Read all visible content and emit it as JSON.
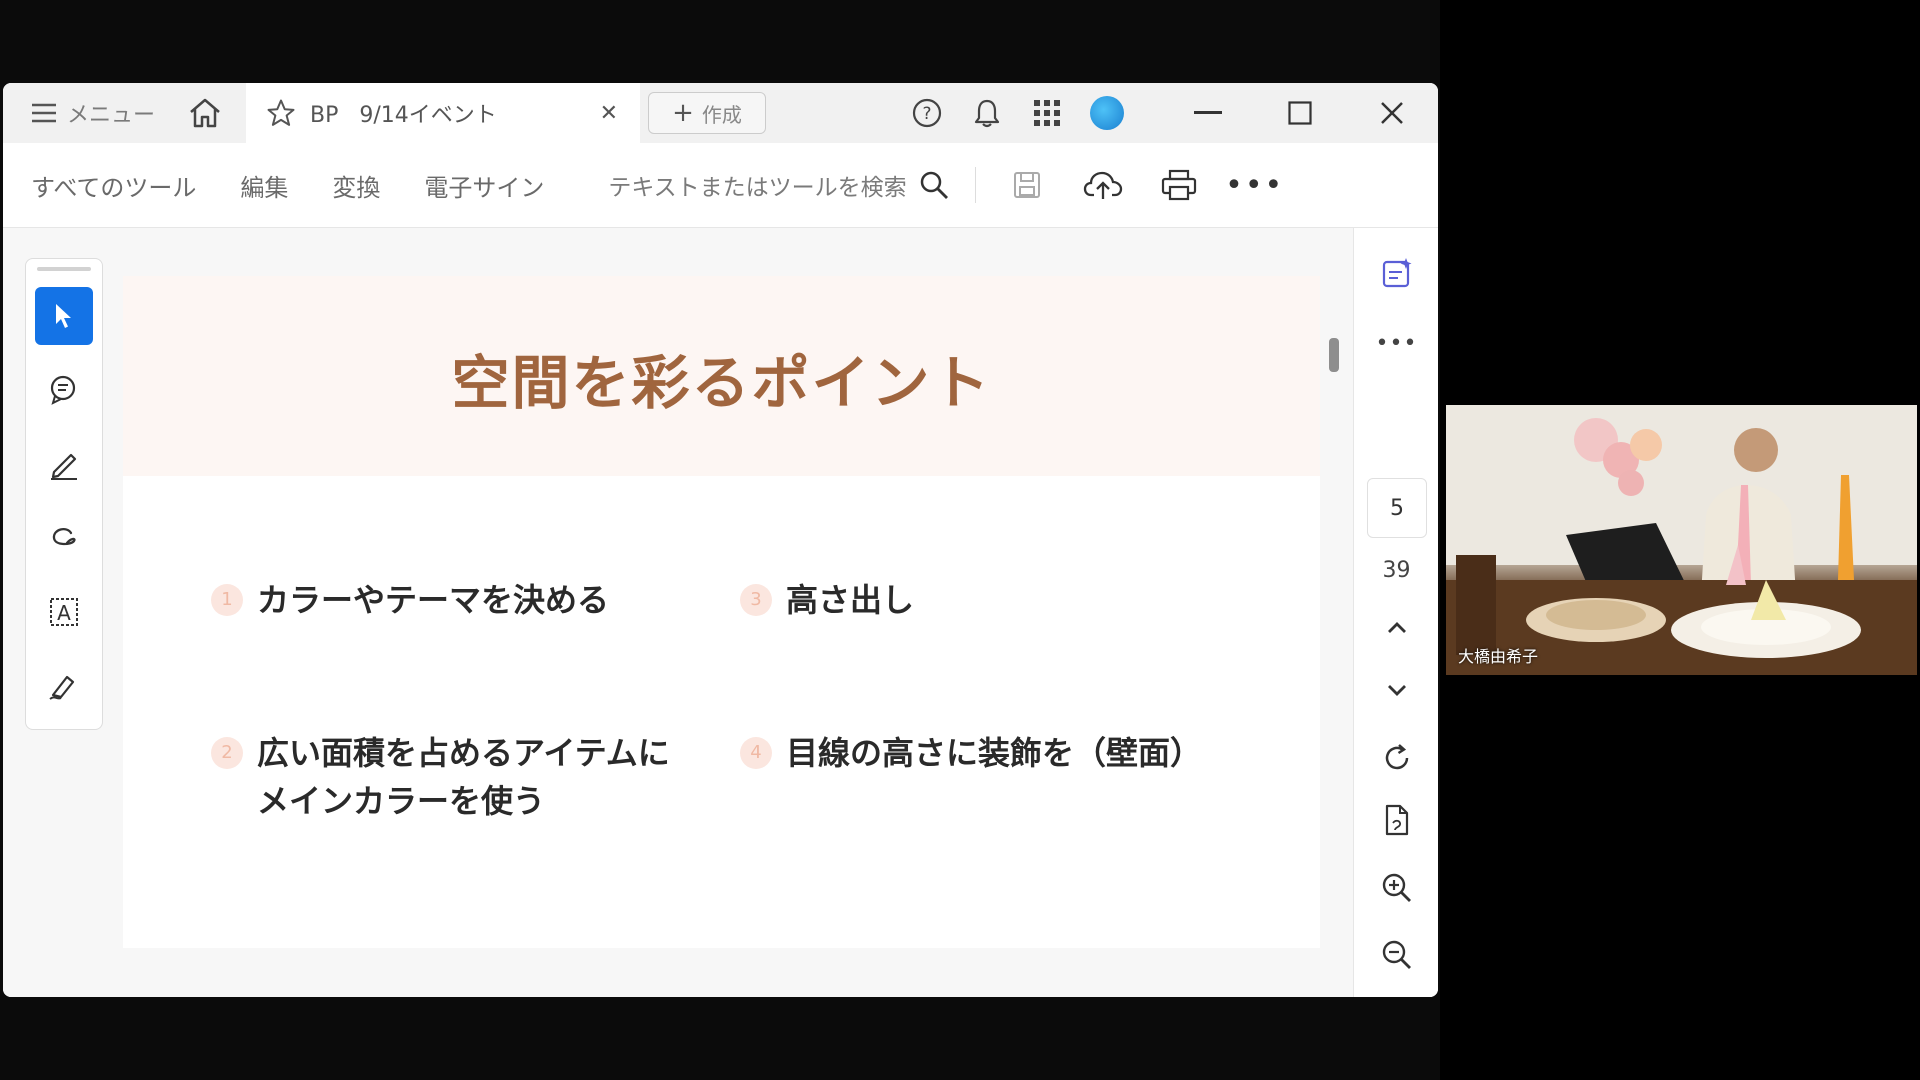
{
  "titlebar": {
    "menu_label": "メニュー",
    "tab_title": "BP   9/14イベント",
    "create_label": "作成"
  },
  "toolbar": {
    "all_tools": "すべてのツール",
    "edit": "編集",
    "convert": "変換",
    "esign": "電子サイン",
    "search_placeholder": "テキストまたはツールを検索"
  },
  "page": {
    "title": "空間を彩るポイント",
    "points": [
      {
        "num": "1",
        "text": "カラーやテーマを決める"
      },
      {
        "num": "2",
        "text": "広い面積を占めるアイテムに\nメインカラーを使う"
      },
      {
        "num": "3",
        "text": "高さ出し"
      },
      {
        "num": "4",
        "text": "目線の高さに装飾を（壁面）"
      }
    ]
  },
  "navigation": {
    "current_page": "5",
    "total_pages": "39"
  },
  "video": {
    "participant_name": "大橋由希子"
  },
  "colors": {
    "accent": "#1473e6",
    "title_brown": "#a0653e",
    "header_bg": "#fdf6f3"
  }
}
